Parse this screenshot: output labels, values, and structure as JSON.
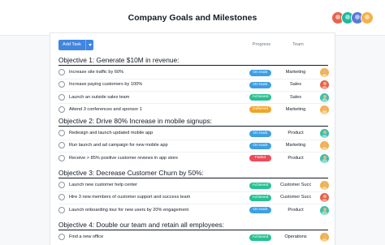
{
  "header": {
    "title": "Company Goals and Milestones",
    "avatars": [
      {
        "name": "member-avatar-1",
        "color": "#e8624c"
      },
      {
        "name": "member-avatar-2",
        "color": "#21b9a0"
      },
      {
        "name": "member-avatar-3",
        "color": "#5b7ad7"
      },
      {
        "name": "member-avatar-4",
        "color": "#f2b24a"
      }
    ]
  },
  "toolbar": {
    "add_task_label": "Add Task",
    "dropdown_icon": "chevron-down-icon"
  },
  "columns": {
    "progress": "Progress",
    "team": "Team"
  },
  "status_colors": {
    "On track": "#3d9fe5",
    "Achieved": "#27c192",
    "Deferred": "#f0a626",
    "Failed": "#ee4b5b"
  },
  "sections": [
    {
      "title": "Objective 1: Generate $10M in revenue:",
      "tasks": [
        {
          "name": "Increase site traffic by 60%",
          "status": "On track",
          "team": "Marketing",
          "assignee_color": "#f2b24a"
        },
        {
          "name": "Increase paying customers by 100%",
          "status": "On track",
          "team": "Sales",
          "assignee_color": "#e8624c"
        },
        {
          "name": "Launch an outside sales team",
          "status": "Achieved",
          "team": "Sales",
          "assignee_color": "#3ac1a8"
        },
        {
          "name": "Attend 3 conferences and sponsor 1",
          "status": "Deferred",
          "team": "Marketing",
          "assignee_color": "#f2b24a"
        }
      ]
    },
    {
      "title": "Objective 2: Drive 80% Increase in mobile signups:",
      "tasks": [
        {
          "name": "Redesign and launch updated mobile app",
          "status": "On track",
          "team": "Product",
          "assignee_color": "#3ac1a8"
        },
        {
          "name": "Run launch and ad campaign for new mobile app",
          "status": "On track",
          "team": "Marketing",
          "assignee_color": "#f2b24a"
        },
        {
          "name": "Receive > 85% positive customer reviews in app store",
          "status": "Failed",
          "team": "Product",
          "assignee_color": "#3ac1a8"
        }
      ]
    },
    {
      "title": "Objective 3: Decrease Customer Churn by 50%:",
      "tasks": [
        {
          "name": "Launch new customer help center",
          "status": "Achieved",
          "team": "Customer Succ...",
          "assignee_color": "#f2b24a"
        },
        {
          "name": "Hire 3 new members of customer support and success team",
          "status": "Achieved",
          "team": "Customer Succ...",
          "assignee_color": "#e8624c"
        },
        {
          "name": "Launch onboarding tour for new users by 20% engagement",
          "status": "On track",
          "team": "Product",
          "assignee_color": "#3ac1a8"
        }
      ]
    },
    {
      "title": "Objective 4: Double our team and retain all employees:",
      "tasks": [
        {
          "name": "Find a new office",
          "status": "Achieved",
          "team": "Operations",
          "assignee_color": "#f2b24a"
        }
      ]
    }
  ]
}
